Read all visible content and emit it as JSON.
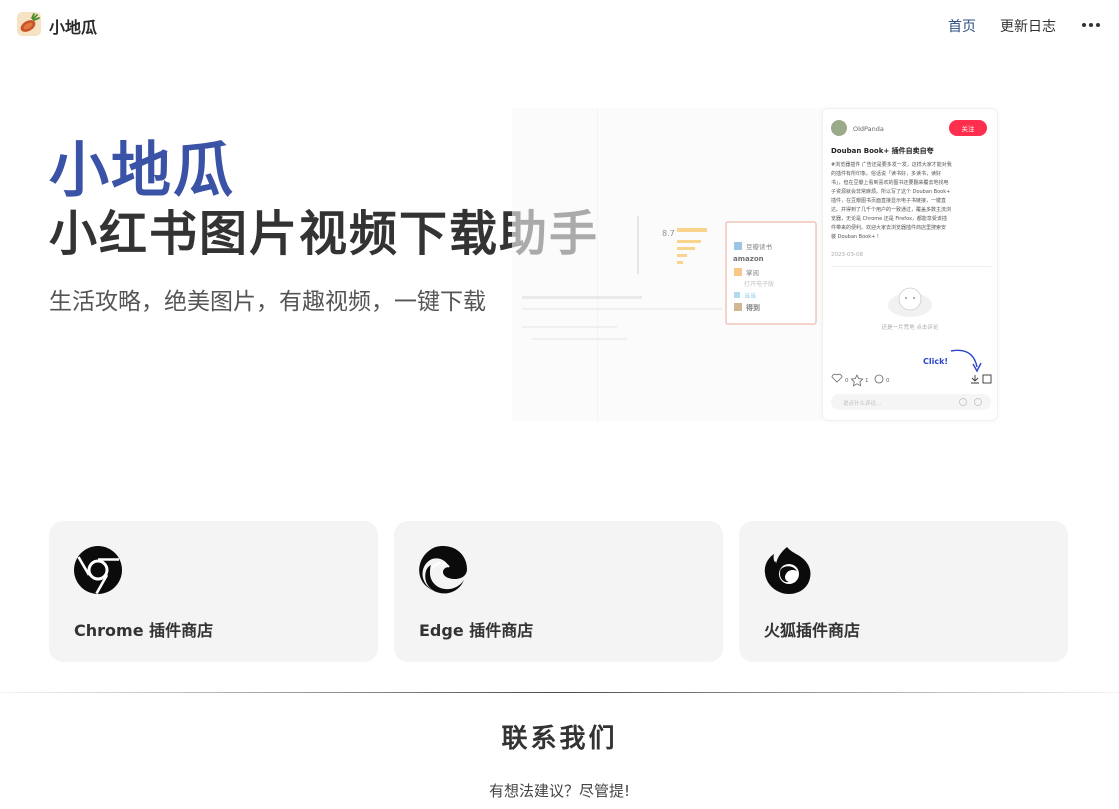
{
  "header": {
    "brand": "小地瓜",
    "logo_icon": "sweet-potato-logo-icon",
    "nav": [
      "首页",
      "更新日志"
    ],
    "more_icon": "more-horizontal-icon",
    "active_color": "#2f4f7f"
  },
  "hero": {
    "title": "小地瓜",
    "subtitle": "小红书图片视频下载助手",
    "tagline": "生活攻略，绝美图片，有趣视频，一键下载",
    "title_color": "#3b53a6"
  },
  "screenshot": {
    "rating": "8.7",
    "store_items": [
      "豆瓣读书",
      "amazon",
      "掌阅",
      "打开电子版",
      "当当",
      "得到"
    ],
    "user_name": "OldPanda",
    "follow_label": "关注",
    "post_title": "Douban Book+ 插件自卖自夸",
    "post_lines": [
      "#浏览器插件 广告还是要多发一发，这样大家才能对我",
      "的插件有所印象。俗话说「读书好，多读书，读好",
      "书」，但在豆瓣上看到喜欢的图书还要翻来覆去地找电",
      "子资源就会非常麻烦。所以写了这个 Douban Book+",
      "插件，在豆瓣图书页面直接显示电子书链接，一键直",
      "达。并得到了几千个用户的一致通过，覆盖多数主流浏",
      "览器，无论是 Chrome 还是 Firefox，都能享受该插",
      "件带来的便利。欢迎大家去浏览器插件商店里搜索安",
      "装 Douban Book+ !"
    ],
    "post_date": "2023-03-08",
    "empty_comment": "还是一片荒地 点击评论",
    "click_label": "Click!",
    "like_count": "0",
    "star_count": "1",
    "comment_count": "0",
    "comment_placeholder": "说点什么评论...",
    "follow_color": "#ff2e4d"
  },
  "stores": [
    {
      "label": "Chrome 插件商店",
      "icon": "chrome-icon"
    },
    {
      "label": "Edge 插件商店",
      "icon": "edge-icon"
    },
    {
      "label": "火狐插件商店",
      "icon": "firefox-icon"
    }
  ],
  "contact": {
    "title": "联系我们",
    "subtitle": "有想法建议？尽管提!"
  }
}
